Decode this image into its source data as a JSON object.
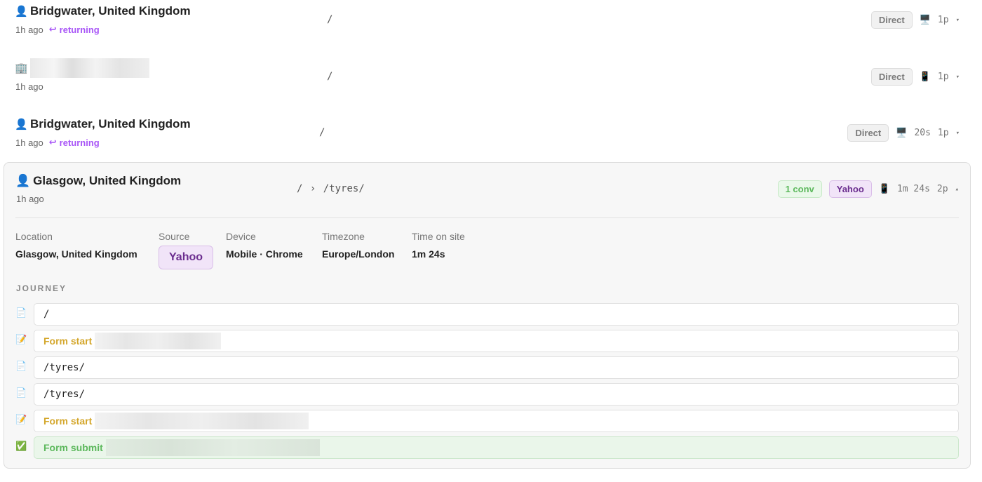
{
  "sessions": [
    {
      "location": "Bridgwater, United Kingdom",
      "time": "1h ago",
      "returning": "returning",
      "path": "/",
      "source": "Direct",
      "duration": "",
      "pages": "1p",
      "person_icon": "👤",
      "device_icon": "🖥️"
    },
    {
      "location": "",
      "time": "1h ago",
      "returning": "",
      "path": "/",
      "source": "Direct",
      "duration": "",
      "pages": "1p",
      "person_icon": "🏢",
      "device_icon": "📱"
    },
    {
      "location": "Bridgwater, United Kingdom",
      "time": "1h ago",
      "returning": "returning",
      "path": "/",
      "source": "Direct",
      "duration": "20s",
      "pages": "1p",
      "person_icon": "👤",
      "device_icon": "🖥️"
    }
  ],
  "expanded": {
    "location": "Glasgow, United Kingdom",
    "time": "1h ago",
    "person_icon": "👤",
    "path_root": "/",
    "path_sep": "›",
    "path_page": "/tyres/",
    "conv": "1 conv",
    "source": "Yahoo",
    "device_icon": "📱",
    "duration": "1m 24s",
    "pages": "2p",
    "details": {
      "location_label": "Location",
      "location_value": "Glasgow, United Kingdom",
      "source_label": "Source",
      "source_value": "Yahoo",
      "device_label": "Device",
      "device_value": "Mobile · Chrome",
      "timezone_label": "Timezone",
      "timezone_value": "Europe/London",
      "time_label": "Time on site",
      "time_value": "1m 24s"
    },
    "journey_label": "JOURNEY",
    "journey": [
      {
        "type": "page",
        "icon": "📄",
        "text": "/"
      },
      {
        "type": "form",
        "icon": "📝",
        "text": "Form start"
      },
      {
        "type": "page",
        "icon": "📄",
        "text": "/tyres/"
      },
      {
        "type": "page",
        "icon": "📄",
        "text": "/tyres/"
      },
      {
        "type": "form",
        "icon": "📝",
        "text": "Form start"
      },
      {
        "type": "submit",
        "icon": "✅",
        "text": "Form submit"
      }
    ]
  },
  "icons": {
    "returning": "↩",
    "collapsed_caret": "▾",
    "expanded_caret": "▴"
  },
  "colors": {
    "returning": "#a855f7",
    "conversion": "#5cb85c",
    "form": "#d4a72c",
    "yahoo": "#6b2d8f"
  }
}
